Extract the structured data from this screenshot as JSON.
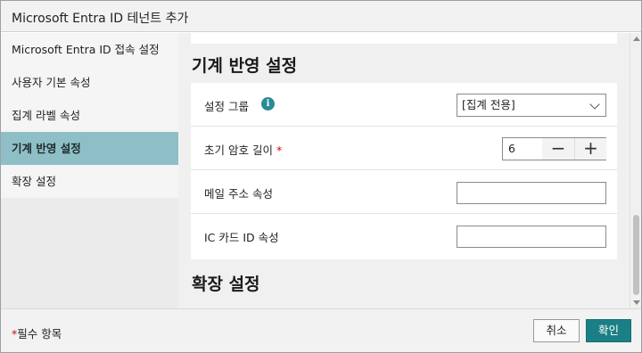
{
  "window": {
    "title": "Microsoft Entra ID 테넌트 추가"
  },
  "sidebar": {
    "items": [
      {
        "label": "Microsoft Entra ID 접속 설정",
        "active": false
      },
      {
        "label": "사용자 기본 속성",
        "active": false
      },
      {
        "label": "집계 라벨 속성",
        "active": false
      },
      {
        "label": "기계 반영 설정",
        "active": true
      },
      {
        "label": "확장 설정",
        "active": false
      }
    ]
  },
  "main": {
    "section_title": "기계 반영 설정",
    "next_section_title": "확장 설정",
    "fields": {
      "group": {
        "label": "설정 그룹",
        "info_icon": "info-icon",
        "value": "[집계 전용]"
      },
      "password_length": {
        "label": "초기 암호 길이",
        "required_mark": "*",
        "value": "6",
        "minus": "−",
        "plus": "+"
      },
      "mail_attr": {
        "label": "메일 주소 속성",
        "value": ""
      },
      "ic_card_attr": {
        "label": "IC 카드 ID 속성",
        "value": ""
      }
    }
  },
  "footer": {
    "required_star": "*",
    "required_text": "필수 항목",
    "cancel_label": "취소",
    "ok_label": "확인"
  },
  "colors": {
    "accent": "#1b7f86",
    "sidebar_active": "#8fbfc6",
    "required": "#d0021b"
  }
}
